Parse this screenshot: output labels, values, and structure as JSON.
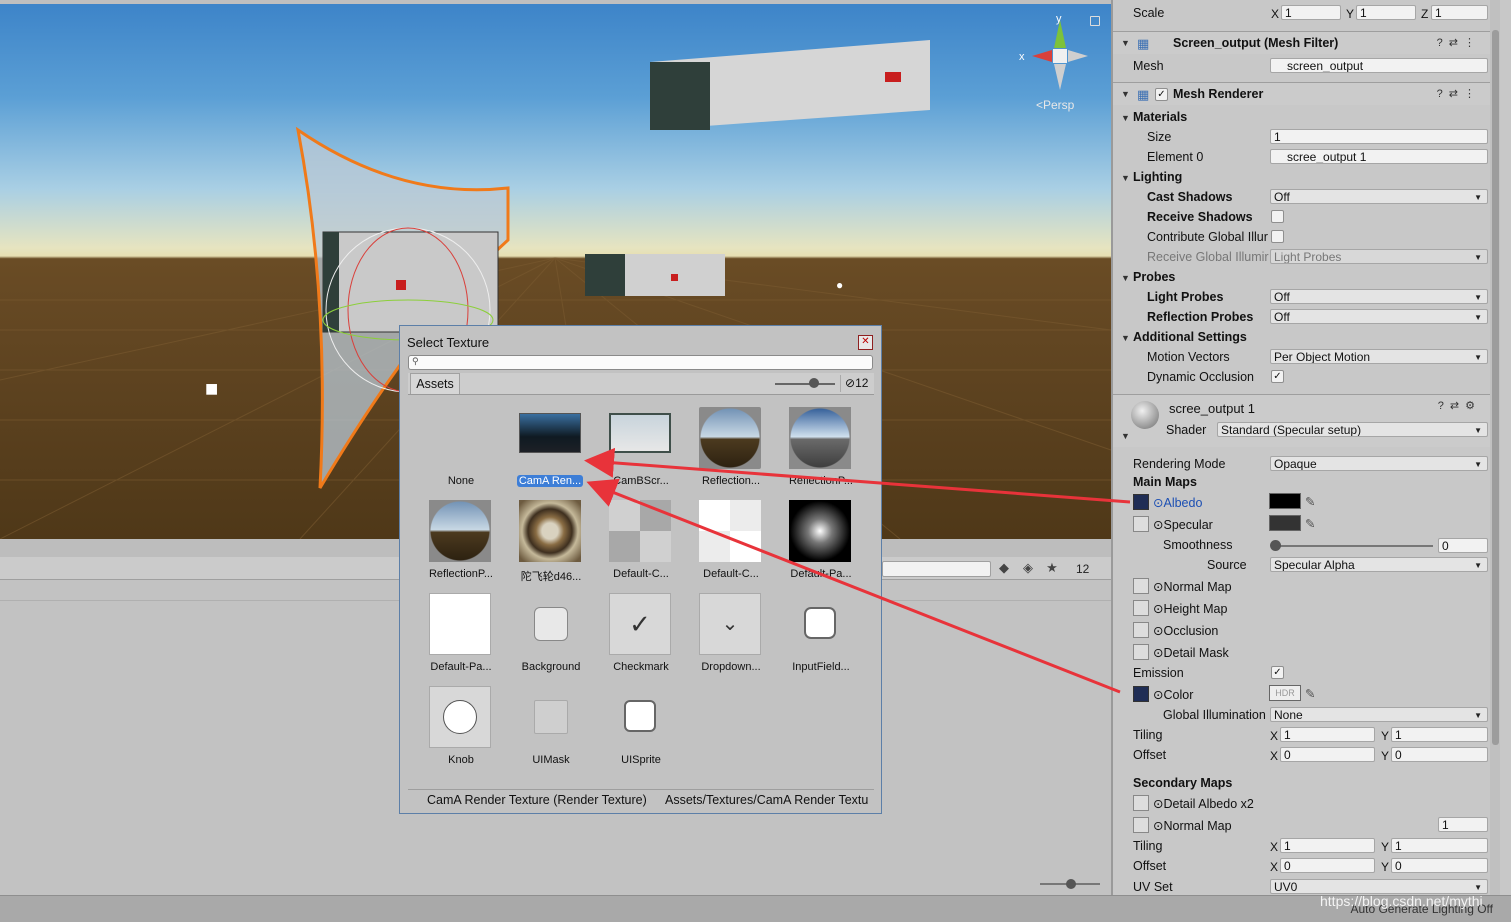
{
  "scene": {
    "persp_label": "<Persp",
    "gizmo": {
      "x": "x",
      "y": "y"
    }
  },
  "lower_panel": {
    "count": "12"
  },
  "status": {
    "text": "Auto Generate Lighting Off",
    "watermark": "https://blog.csdn.net/mythi"
  },
  "inspector": {
    "transform_scale": {
      "label": "Scale",
      "x": "1",
      "y": "1",
      "z": "1"
    },
    "mesh_filter": {
      "title": "Screen_output (Mesh Filter)",
      "mesh_label": "Mesh",
      "mesh_value": "screen_output"
    },
    "mesh_renderer": {
      "title": "Mesh Renderer",
      "materials": "Materials",
      "size_label": "Size",
      "size_value": "1",
      "element0_label": "Element 0",
      "element0_value": "scree_output 1",
      "lighting": "Lighting",
      "cast_shadows_label": "Cast Shadows",
      "cast_shadows_value": "Off",
      "receive_shadows_label": "Receive Shadows",
      "contrib_gi_label": "Contribute Global Illur",
      "receive_gi_label": "Receive Global Illumir",
      "receive_gi_value": "Light Probes",
      "probes": "Probes",
      "light_probes_label": "Light Probes",
      "light_probes_value": "Off",
      "reflection_probes_label": "Reflection Probes",
      "reflection_probes_value": "Off",
      "additional": "Additional Settings",
      "motion_vectors_label": "Motion Vectors",
      "motion_vectors_value": "Per Object Motion",
      "dynamic_occlusion_label": "Dynamic Occlusion"
    },
    "material": {
      "name": "scree_output 1",
      "shader_label": "Shader",
      "shader_value": "Standard (Specular setup)",
      "rendering_mode_label": "Rendering Mode",
      "rendering_mode_value": "Opaque",
      "main_maps": "Main Maps",
      "albedo": "Albedo",
      "specular": "Specular",
      "smoothness_label": "Smoothness",
      "smoothness_value": "0",
      "source_label": "Source",
      "source_value": "Specular Alpha",
      "normal_map": "Normal Map",
      "height_map": "Height Map",
      "occlusion": "Occlusion",
      "detail_mask": "Detail Mask",
      "emission": "Emission",
      "color": "Color",
      "hdr": "HDR",
      "global_illum_label": "Global Illumination",
      "global_illum_value": "None",
      "tiling_label": "Tiling",
      "tiling_x": "1",
      "tiling_y": "1",
      "offset_label": "Offset",
      "offset_x": "0",
      "offset_y": "0",
      "secondary_maps": "Secondary Maps",
      "detail_albedo": "Detail Albedo x2",
      "sec_normal_map": "Normal Map",
      "sec_normal_value": "1",
      "sec_tiling_x": "1",
      "sec_tiling_y": "1",
      "sec_offset_x": "0",
      "sec_offset_y": "0",
      "uvset_label": "UV Set",
      "uvset_value": "UV0"
    },
    "axis": {
      "x": "X",
      "y": "Y",
      "z": "Z"
    }
  },
  "dialog": {
    "title": "Select Texture",
    "tab": "Assets",
    "count": "12",
    "items": [
      {
        "label": "None"
      },
      {
        "label": "CamA Ren..."
      },
      {
        "label": "CamBScr..."
      },
      {
        "label": "Reflection..."
      },
      {
        "label": "ReflectionP..."
      },
      {
        "label": "ReflectionP..."
      },
      {
        "label": "陀飞轮d46..."
      },
      {
        "label": "Default-C..."
      },
      {
        "label": "Default-C..."
      },
      {
        "label": "Default-Pa..."
      },
      {
        "label": "Default-Pa..."
      },
      {
        "label": "Background"
      },
      {
        "label": "Checkmark"
      },
      {
        "label": "Dropdown..."
      },
      {
        "label": "InputField..."
      },
      {
        "label": "Knob"
      },
      {
        "label": "UIMask"
      },
      {
        "label": "UISprite"
      }
    ],
    "footer_name": "CamA Render Texture (Render Texture)",
    "footer_path": "Assets/Textures/CamA Render Textu"
  },
  "colors": {
    "selection": "#3d7ed7",
    "arrow": "#e8333a",
    "outline": "#f07a1a"
  }
}
